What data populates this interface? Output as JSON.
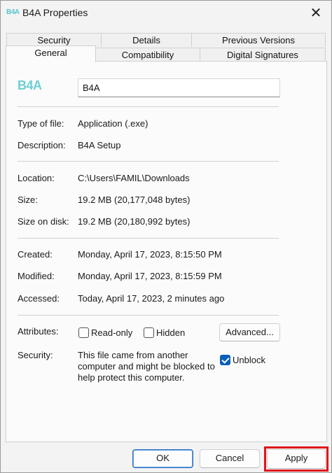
{
  "window": {
    "title": "B4A Properties",
    "app_icon_text": "B4A"
  },
  "tabs": {
    "row1": [
      "Security",
      "Details",
      "Previous Versions"
    ],
    "row2": [
      "General",
      "Compatibility",
      "Digital Signatures"
    ],
    "active": "General"
  },
  "general": {
    "logo_text": "B4A",
    "file_name": "B4A",
    "type_label": "Type of file:",
    "type_value": "Application (.exe)",
    "description_label": "Description:",
    "description_value": "B4A Setup",
    "location_label": "Location:",
    "location_value": "C:\\Users\\FAMIL\\Downloads",
    "size_label": "Size:",
    "size_value": "19.2 MB (20,177,048 bytes)",
    "size_on_disk_label": "Size on disk:",
    "size_on_disk_value": "19.2 MB (20,180,992 bytes)",
    "created_label": "Created:",
    "created_value": "Monday, April 17, 2023, 8:15:50 PM",
    "modified_label": "Modified:",
    "modified_value": "Monday, April 17, 2023, 8:15:59 PM",
    "accessed_label": "Accessed:",
    "accessed_value": "Today, April 17, 2023, 2 minutes ago",
    "attributes_label": "Attributes:",
    "readonly_label": "Read-only",
    "readonly_checked": false,
    "hidden_label": "Hidden",
    "hidden_checked": false,
    "advanced_label": "Advanced...",
    "security_label": "Security:",
    "security_text": "This file came from another computer and might be blocked to help protect this computer.",
    "unblock_label": "Unblock",
    "unblock_checked": true
  },
  "footer": {
    "ok_label": "OK",
    "cancel_label": "Cancel",
    "apply_label": "Apply"
  },
  "colors": {
    "accent": "#0a5fb7",
    "highlight": "#e0141c",
    "logo": "#6dcfd6"
  }
}
